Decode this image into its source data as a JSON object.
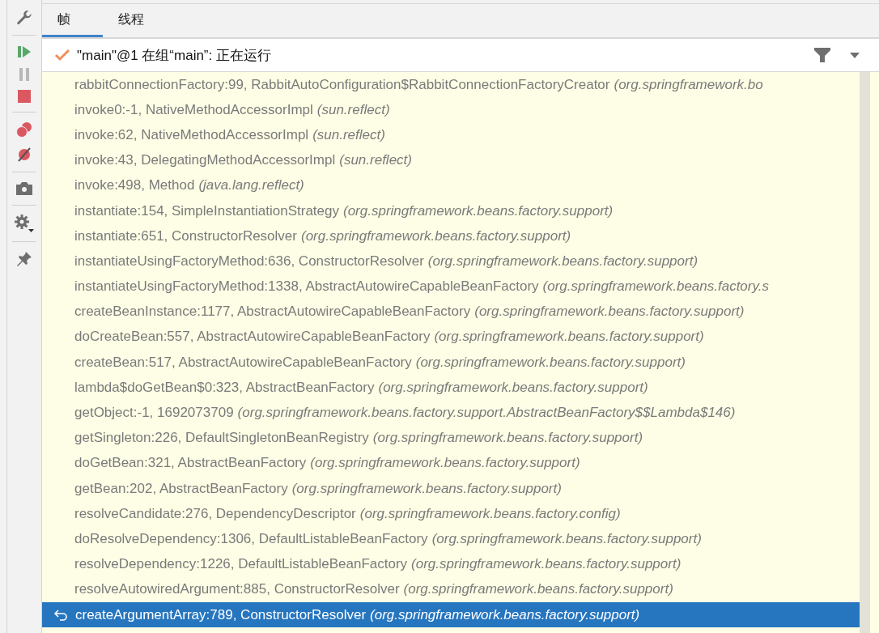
{
  "tabs": [
    {
      "label": "帧",
      "selected": true
    },
    {
      "label": "线程",
      "selected": false
    }
  ],
  "thread": {
    "label": "\"main\"@1 在组“main”: 正在运行"
  },
  "frames": [
    {
      "method": "rabbitConnectionFactory:99, RabbitAutoConfiguration$RabbitConnectionFactoryCreator",
      "package": "(org.springframework.bo",
      "selected": false
    },
    {
      "method": "invoke0:-1, NativeMethodAccessorImpl",
      "package": "(sun.reflect)",
      "selected": false
    },
    {
      "method": "invoke:62, NativeMethodAccessorImpl",
      "package": "(sun.reflect)",
      "selected": false
    },
    {
      "method": "invoke:43, DelegatingMethodAccessorImpl",
      "package": "(sun.reflect)",
      "selected": false
    },
    {
      "method": "invoke:498, Method",
      "package": "(java.lang.reflect)",
      "selected": false
    },
    {
      "method": "instantiate:154, SimpleInstantiationStrategy",
      "package": "(org.springframework.beans.factory.support)",
      "selected": false
    },
    {
      "method": "instantiate:651, ConstructorResolver",
      "package": "(org.springframework.beans.factory.support)",
      "selected": false
    },
    {
      "method": "instantiateUsingFactoryMethod:636, ConstructorResolver",
      "package": "(org.springframework.beans.factory.support)",
      "selected": false
    },
    {
      "method": "instantiateUsingFactoryMethod:1338, AbstractAutowireCapableBeanFactory",
      "package": "(org.springframework.beans.factory.s",
      "selected": false
    },
    {
      "method": "createBeanInstance:1177, AbstractAutowireCapableBeanFactory",
      "package": "(org.springframework.beans.factory.support)",
      "selected": false
    },
    {
      "method": "doCreateBean:557, AbstractAutowireCapableBeanFactory",
      "package": "(org.springframework.beans.factory.support)",
      "selected": false
    },
    {
      "method": "createBean:517, AbstractAutowireCapableBeanFactory",
      "package": "(org.springframework.beans.factory.support)",
      "selected": false
    },
    {
      "method": "lambda$doGetBean$0:323, AbstractBeanFactory",
      "package": "(org.springframework.beans.factory.support)",
      "selected": false
    },
    {
      "method": "getObject:-1, 1692073709",
      "package": "(org.springframework.beans.factory.support.AbstractBeanFactory$$Lambda$146)",
      "selected": false
    },
    {
      "method": "getSingleton:226, DefaultSingletonBeanRegistry",
      "package": "(org.springframework.beans.factory.support)",
      "selected": false
    },
    {
      "method": "doGetBean:321, AbstractBeanFactory",
      "package": "(org.springframework.beans.factory.support)",
      "selected": false
    },
    {
      "method": "getBean:202, AbstractBeanFactory",
      "package": "(org.springframework.beans.factory.support)",
      "selected": false
    },
    {
      "method": "resolveCandidate:276, DependencyDescriptor",
      "package": "(org.springframework.beans.factory.config)",
      "selected": false
    },
    {
      "method": "doResolveDependency:1306, DefaultListableBeanFactory",
      "package": "(org.springframework.beans.factory.support)",
      "selected": false
    },
    {
      "method": "resolveDependency:1226, DefaultListableBeanFactory",
      "package": "(org.springframework.beans.factory.support)",
      "selected": false
    },
    {
      "method": "resolveAutowiredArgument:885, ConstructorResolver",
      "package": "(org.springframework.beans.factory.support)",
      "selected": false
    },
    {
      "method": "createArgumentArray:789, ConstructorResolver",
      "package": "(org.springframework.beans.factory.support)",
      "selected": true
    }
  ]
}
